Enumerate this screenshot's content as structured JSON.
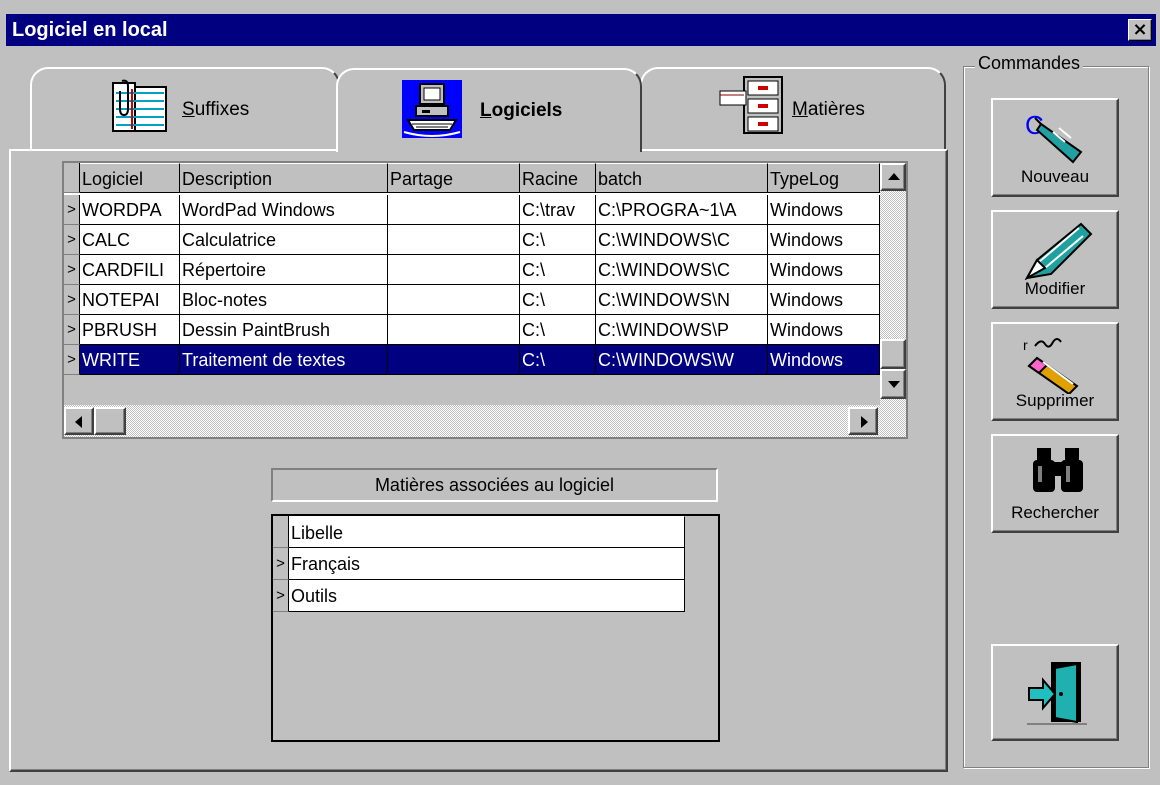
{
  "window": {
    "title": "Logiciel en local",
    "close_symbol": "×"
  },
  "tabs": [
    {
      "label_prefix": "",
      "underlined": "S",
      "label_rest": "uffixes",
      "icon": "notebook-icon",
      "active": false
    },
    {
      "label_prefix": "",
      "underlined": "L",
      "label_rest": "ogiciels",
      "icon": "computer-icon",
      "active": true
    },
    {
      "label_prefix": "",
      "underlined": "M",
      "label_rest": "atières",
      "icon": "file-cabinet-icon",
      "active": false
    }
  ],
  "grid": {
    "columns": [
      "Logiciel",
      "Description",
      "Partage",
      "Racine",
      "batch",
      "TypeLog"
    ],
    "rows": [
      {
        "indicator": ">",
        "cells": [
          "WORDPA",
          "WordPad Windows",
          "",
          "C:\\trav",
          "C:\\PROGRA~1\\A",
          "Windows"
        ]
      },
      {
        "indicator": ">",
        "cells": [
          "CALC",
          "Calculatrice",
          "",
          "C:\\",
          "C:\\WINDOWS\\C",
          "Windows"
        ]
      },
      {
        "indicator": ">",
        "cells": [
          "CARDFILI",
          "Répertoire",
          "",
          "C:\\",
          "C:\\WINDOWS\\C",
          "Windows"
        ]
      },
      {
        "indicator": ">",
        "cells": [
          "NOTEPAI",
          "Bloc-notes",
          "",
          "C:\\",
          "C:\\WINDOWS\\N",
          "Windows"
        ]
      },
      {
        "indicator": ">",
        "cells": [
          "PBRUSH",
          "Dessin PaintBrush",
          "",
          "C:\\",
          "C:\\WINDOWS\\P",
          "Windows"
        ]
      },
      {
        "indicator": ">",
        "cells": [
          "WRITE",
          "Traitement de textes",
          "",
          "C:\\",
          "C:\\WINDOWS\\W",
          "Windows"
        ],
        "selected": true
      }
    ]
  },
  "associated": {
    "title": "Matières associées au logiciel",
    "header": "Libelle",
    "rows": [
      {
        "indicator": ">",
        "value": "Français"
      },
      {
        "indicator": ">",
        "value": "Outils"
      }
    ]
  },
  "commands": {
    "frame_title": "Commandes",
    "buttons": [
      {
        "name": "nouveau-button",
        "label": "Nouveau",
        "icon": "pen-new-icon"
      },
      {
        "name": "modifier-button",
        "label": "Modifier",
        "icon": "pen-edit-icon"
      },
      {
        "name": "supprimer-button",
        "label": "Supprimer",
        "icon": "eraser-icon"
      },
      {
        "name": "rechercher-button",
        "label": "Rechercher",
        "icon": "binoculars-icon"
      },
      {
        "name": "exit-button",
        "label": "",
        "icon": "exit-door-icon"
      }
    ]
  }
}
